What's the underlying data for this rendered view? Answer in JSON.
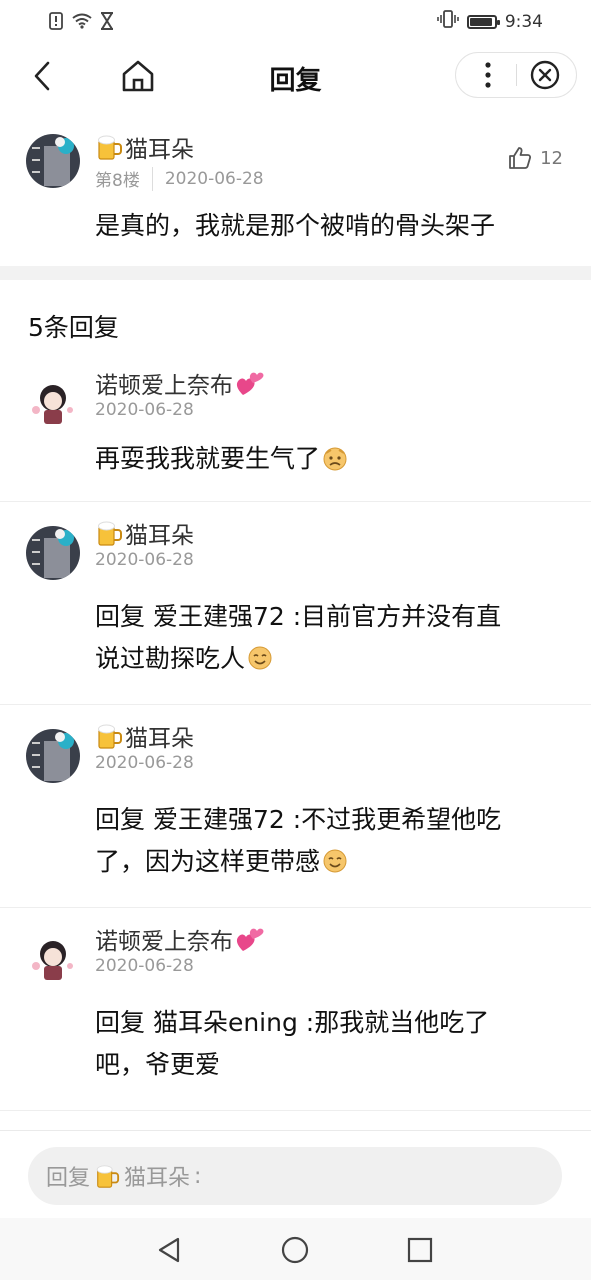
{
  "status_bar": {
    "time": "9:34",
    "left_icons": [
      "alert-icon",
      "wifi-icon",
      "hourglass-icon"
    ],
    "right_icons": [
      "vibrate-icon",
      "battery-icon"
    ],
    "battery_level": 0.9
  },
  "header": {
    "title": "回复"
  },
  "main_post": {
    "username": "猫耳朵",
    "floor": "第8楼",
    "date": "2020-06-28",
    "likes": "12",
    "content": "是真的，我就是那个被啃的骨头架子"
  },
  "replies_header": "5条回复",
  "replies": [
    {
      "username": "诺顿爱上奈布",
      "date": "2020-06-28",
      "text": "再耍我我就要生气了"
    },
    {
      "username": "猫耳朵",
      "date": "2020-06-28",
      "text_line1": "回复 爱王建强72 :目前官方并没有直",
      "text_line2": "说过勘探吃人"
    },
    {
      "username": "猫耳朵",
      "date": "2020-06-28",
      "text_line1": "回复 爱王建强72 :不过我更希望他吃",
      "text_line2": "了，因为这样更带感"
    },
    {
      "username": "诺顿爱上奈布",
      "date": "2020-06-28",
      "text_line1": "回复 猫耳朵ening :那我就当他吃了",
      "text_line2": "吧，爷更爱"
    }
  ],
  "input": {
    "prefix": "回复",
    "target": "猫耳朵",
    "suffix": ":"
  },
  "colors": {
    "accent": "#333333",
    "muted": "#999999",
    "divider": "#f2f2f2"
  }
}
